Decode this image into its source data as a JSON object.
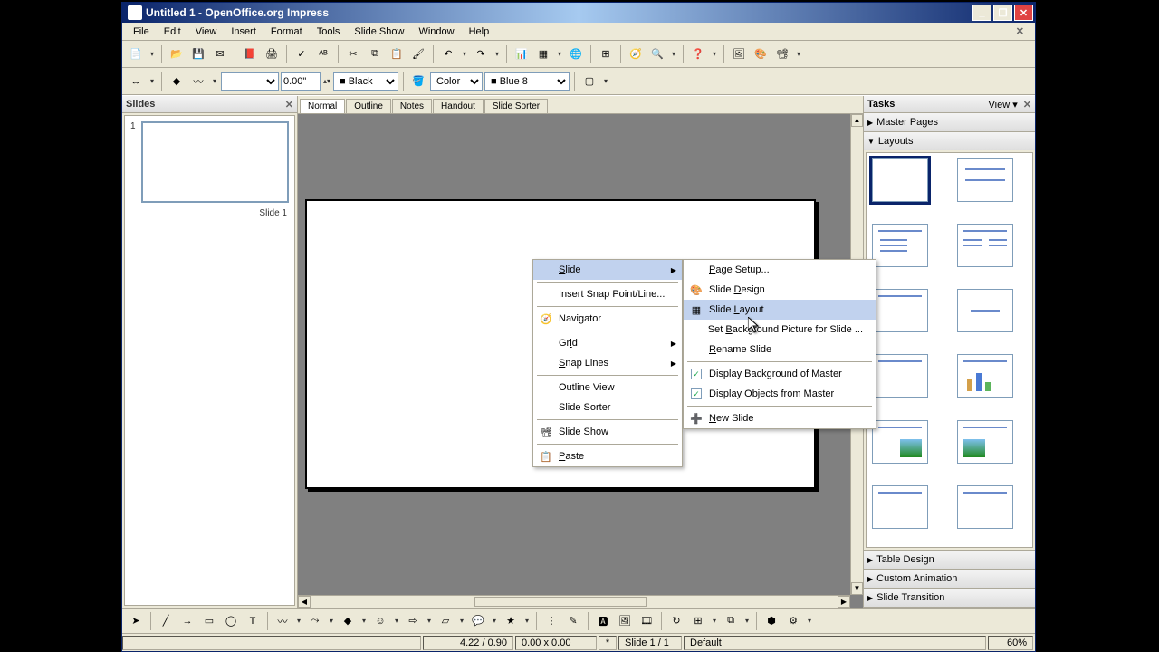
{
  "window": {
    "title": "Untitled 1 - OpenOffice.org Impress"
  },
  "menubar": [
    "File",
    "Edit",
    "View",
    "Insert",
    "Format",
    "Tools",
    "Slide Show",
    "Window",
    "Help"
  ],
  "toolbar2": {
    "width": "0.00\"",
    "line_color_label": "Black",
    "fill_mode": "Color",
    "fill_color_label": "Blue 8",
    "line_color": "#000000",
    "fill_color": "#3366cc"
  },
  "slides_panel": {
    "title": "Slides",
    "thumb_number": "1",
    "thumb_label": "Slide 1"
  },
  "view_tabs": [
    "Normal",
    "Outline",
    "Notes",
    "Handout",
    "Slide Sorter"
  ],
  "active_view_tab": 0,
  "tasks_panel": {
    "title": "Tasks",
    "view_label": "View",
    "sections": [
      "Master Pages",
      "Layouts",
      "Table Design",
      "Custom Animation",
      "Slide Transition"
    ],
    "expanded_section": 1
  },
  "context_menu": {
    "items": [
      {
        "label": "Slide",
        "submenu": true,
        "hover": true
      },
      {
        "label": "Insert Snap Point/Line..."
      },
      {
        "label": "Navigator",
        "icon": "compass"
      },
      {
        "label": "Grid",
        "submenu": true
      },
      {
        "label": "Snap Lines",
        "submenu": true
      },
      {
        "label": "Outline View"
      },
      {
        "label": "Slide Sorter"
      },
      {
        "label": "Slide Show",
        "icon": "screen"
      },
      {
        "label": "Paste",
        "icon": "paste"
      }
    ],
    "submenu": [
      {
        "label": "Page Setup..."
      },
      {
        "label": "Slide Design",
        "icon": "design"
      },
      {
        "label": "Slide Layout",
        "icon": "layout",
        "hover": true
      },
      {
        "label": "Set Background Picture for Slide ..."
      },
      {
        "label": "Rename Slide"
      },
      {
        "label": "Display Background of Master",
        "checked": true
      },
      {
        "label": "Display Objects from Master",
        "checked": true
      },
      {
        "label": "New Slide",
        "icon": "new"
      }
    ]
  },
  "statusbar": {
    "coords": "4.22 / 0.90",
    "size": "0.00 x 0.00",
    "modified": "*",
    "slide": "Slide 1 / 1",
    "style": "Default",
    "zoom": "60%"
  }
}
